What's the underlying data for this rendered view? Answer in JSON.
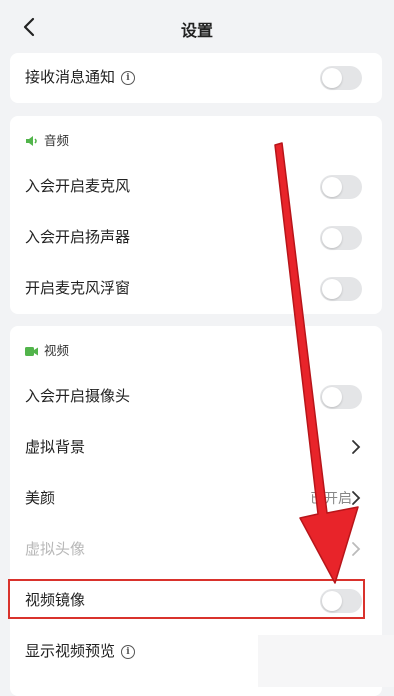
{
  "header": {
    "title": "设置"
  },
  "notifications": {
    "label": "接收消息通知"
  },
  "audio": {
    "section_title": "音频",
    "items": [
      {
        "label": "入会开启麦克风"
      },
      {
        "label": "入会开启扬声器"
      },
      {
        "label": "开启麦克风浮窗"
      }
    ]
  },
  "video": {
    "section_title": "视频",
    "items": [
      {
        "label": "入会开启摄像头",
        "type": "toggle"
      },
      {
        "label": "虚拟背景",
        "type": "link"
      },
      {
        "label": "美颜",
        "type": "link",
        "value": "已开启"
      },
      {
        "label": "虚拟头像",
        "type": "link"
      },
      {
        "label": "视频镜像",
        "type": "toggle"
      },
      {
        "label": "显示视频预览",
        "type": "toggle"
      }
    ]
  },
  "colors": {
    "section_icon": "#52b44b",
    "highlight": "#d9322c",
    "arrow": "#e8242a"
  },
  "icons": [
    "back-chevron-icon",
    "info-icon",
    "speaker-icon",
    "video-camera-icon",
    "chevron-right-icon"
  ]
}
